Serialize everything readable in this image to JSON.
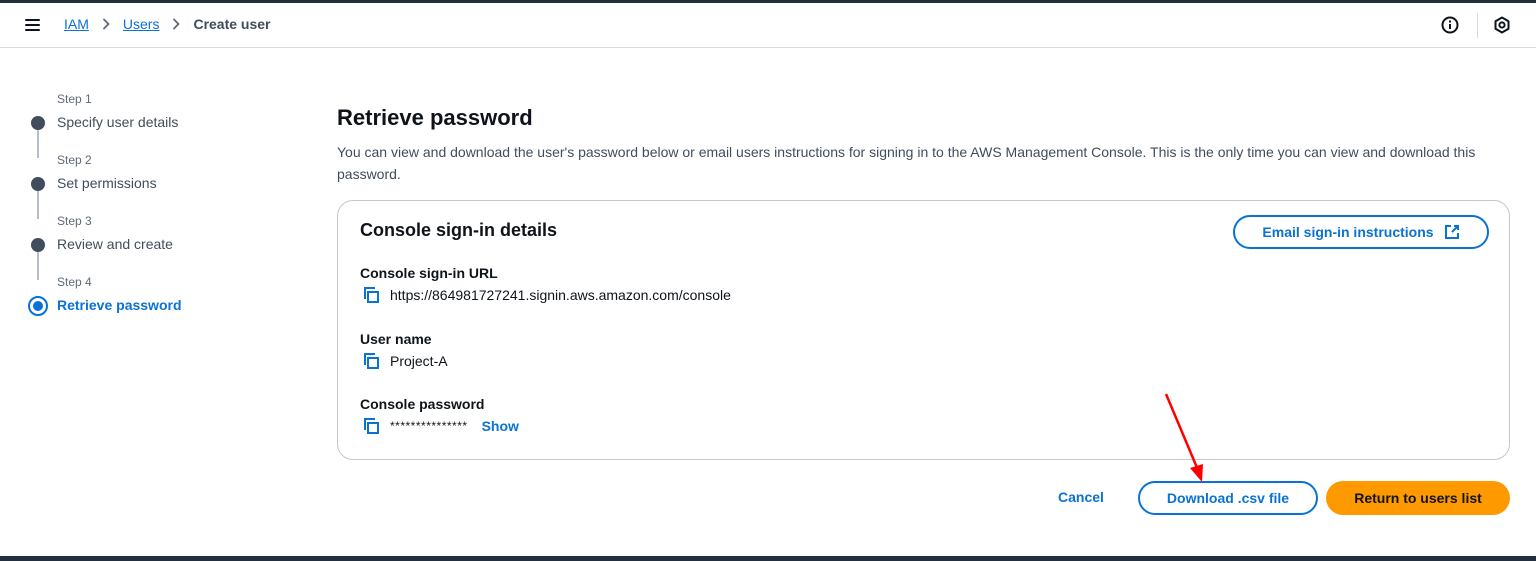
{
  "breadcrumb": {
    "items": [
      "IAM",
      "Users"
    ],
    "current": "Create user"
  },
  "wizard": {
    "steps": [
      {
        "number": "Step 1",
        "title": "Specify user details"
      },
      {
        "number": "Step 2",
        "title": "Set permissions"
      },
      {
        "number": "Step 3",
        "title": "Review and create"
      },
      {
        "number": "Step 4",
        "title": "Retrieve password"
      }
    ],
    "active_index": 3
  },
  "main": {
    "title": "Retrieve password",
    "description": "You can view and download the user's password below or email users instructions for signing in to the AWS Management Console. This is the only time you can view and download this password."
  },
  "card": {
    "title": "Console sign-in details",
    "email_button": "Email sign-in instructions",
    "url_label": "Console sign-in URL",
    "url_value": "https://864981727241.signin.aws.amazon.com/console",
    "username_label": "User name",
    "username_value": "Project-A",
    "password_label": "Console password",
    "password_masked": "***************",
    "show_label": "Show"
  },
  "actions": {
    "cancel": "Cancel",
    "download": "Download .csv file",
    "return": "Return to users list"
  },
  "colors": {
    "link": "#0972d3",
    "primary": "#ff9900",
    "annotation": "#ff0000"
  }
}
